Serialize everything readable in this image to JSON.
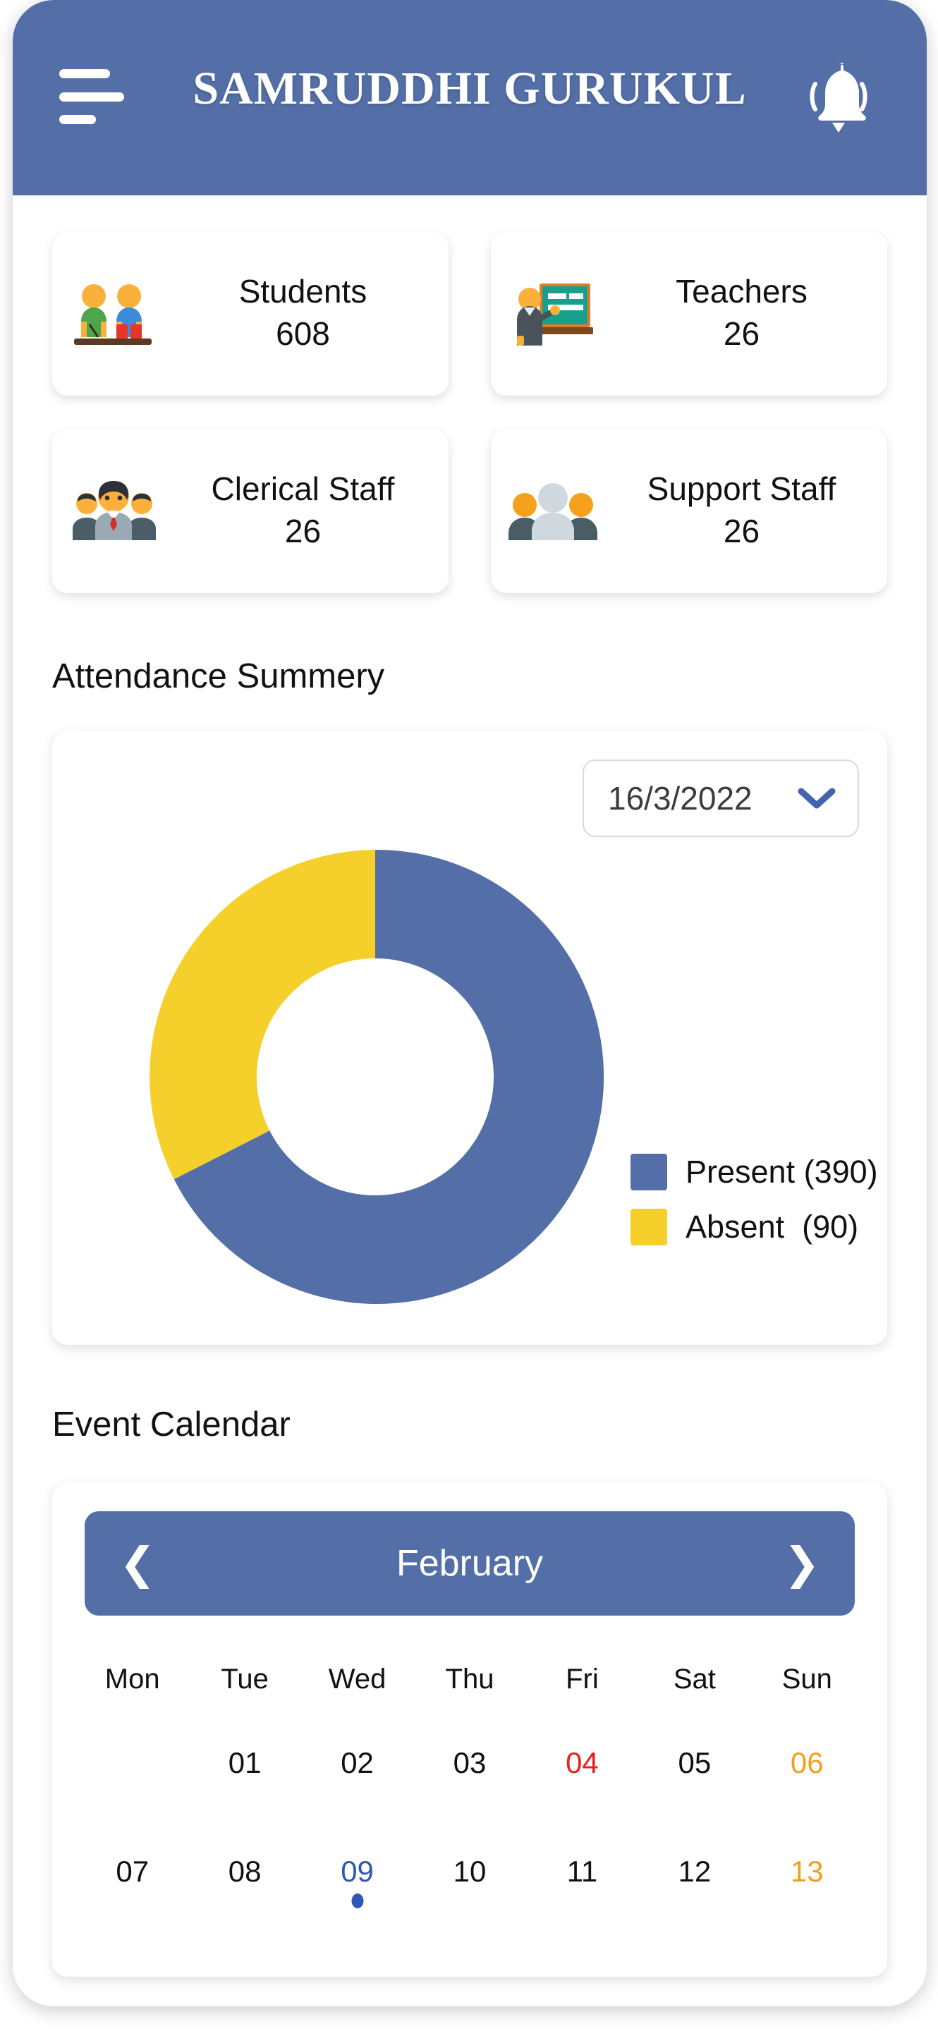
{
  "theme": {
    "primary_blue": "#546FA8",
    "accent_yellow": "#F5D02B",
    "holiday_red": "#E8201A",
    "weekend_orange": "#F0A01E",
    "event_blue": "#2F57B5"
  },
  "header": {
    "title": "SAMRUDDHI GURUKUL",
    "menu_icon": "hamburger-icon",
    "notification_icon": "bell-icon"
  },
  "stats": [
    {
      "label": "Students",
      "value": "608",
      "icon": "students-at-desk-icon"
    },
    {
      "label": "Teachers",
      "value": "26",
      "icon": "teacher-at-board-icon"
    },
    {
      "label": "Clerical Staff",
      "value": "26",
      "icon": "business-people-icon"
    },
    {
      "label": "Support Staff",
      "value": "26",
      "icon": "people-group-icon"
    }
  ],
  "attendance": {
    "section_title": "Attendance Summery",
    "date_value": "16/3/2022",
    "dropdown_icon": "chevron-down-icon"
  },
  "calendar": {
    "section_title": "Event Calendar",
    "month": "February",
    "prev_icon": "chevron-left-icon",
    "next_icon": "chevron-right-icon",
    "weekdays": [
      "Mon",
      "Tue",
      "Wed",
      "Thu",
      "Fri",
      "Sat",
      "Sun"
    ],
    "weeks": [
      [
        {
          "label": "",
          "style": ""
        },
        {
          "label": "01",
          "style": ""
        },
        {
          "label": "02",
          "style": ""
        },
        {
          "label": "03",
          "style": ""
        },
        {
          "label": "04",
          "style": "red"
        },
        {
          "label": "05",
          "style": ""
        },
        {
          "label": "06",
          "style": "orange"
        }
      ],
      [
        {
          "label": "07",
          "style": ""
        },
        {
          "label": "08",
          "style": ""
        },
        {
          "label": "09",
          "style": "blue",
          "event": true
        },
        {
          "label": "10",
          "style": ""
        },
        {
          "label": "11",
          "style": ""
        },
        {
          "label": "12",
          "style": ""
        },
        {
          "label": "13",
          "style": "orange"
        }
      ]
    ]
  },
  "chart_data": {
    "type": "pie",
    "variant": "donut",
    "title": "Attendance Summery",
    "labels": [
      "Present",
      "Absent"
    ],
    "values": [
      390,
      90
    ],
    "legend_entries": [
      "Present (390)",
      "Absent  (90)"
    ],
    "colors": [
      "#546FA8",
      "#F5D02B"
    ],
    "legend_position": "right",
    "start_angle_deg": 0,
    "direction": "clockwise",
    "inner_radius_ratio": 0.52,
    "slice_angles_deg": [
      260,
      100
    ]
  }
}
